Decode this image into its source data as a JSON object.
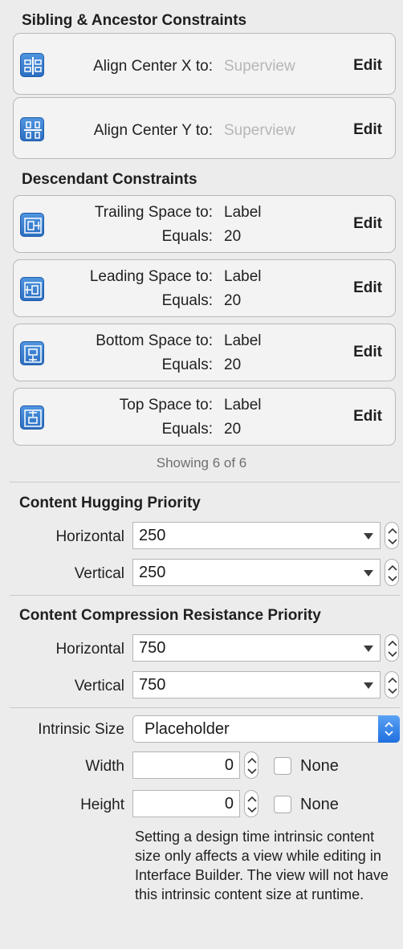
{
  "sibling_section": {
    "title": "Sibling & Ancestor Constraints",
    "constraints": [
      {
        "label": "Align Center X to:",
        "value": "Superview",
        "edit": "Edit",
        "icon": "align-center-x-icon"
      },
      {
        "label": "Align Center Y to:",
        "value": "Superview",
        "edit": "Edit",
        "icon": "align-center-y-icon"
      }
    ]
  },
  "descendant_section": {
    "title": "Descendant Constraints",
    "constraints": [
      {
        "label": "Trailing Space to:",
        "value": "Label",
        "equals_label": "Equals:",
        "equals_value": "20",
        "edit": "Edit",
        "icon": "trailing-space-icon"
      },
      {
        "label": "Leading Space to:",
        "value": "Label",
        "equals_label": "Equals:",
        "equals_value": "20",
        "edit": "Edit",
        "icon": "leading-space-icon"
      },
      {
        "label": "Bottom Space to:",
        "value": "Label",
        "equals_label": "Equals:",
        "equals_value": "20",
        "edit": "Edit",
        "icon": "bottom-space-icon"
      },
      {
        "label": "Top Space to:",
        "value": "Label",
        "equals_label": "Equals:",
        "equals_value": "20",
        "edit": "Edit",
        "icon": "top-space-icon"
      }
    ],
    "showing": "Showing 6 of 6"
  },
  "hugging": {
    "title": "Content Hugging Priority",
    "horizontal_label": "Horizontal",
    "horizontal_value": "250",
    "vertical_label": "Vertical",
    "vertical_value": "250"
  },
  "compression": {
    "title": "Content Compression Resistance Priority",
    "horizontal_label": "Horizontal",
    "horizontal_value": "750",
    "vertical_label": "Vertical",
    "vertical_value": "750"
  },
  "intrinsic": {
    "label": "Intrinsic Size",
    "value": "Placeholder",
    "width_label": "Width",
    "width_value": "0",
    "height_label": "Height",
    "height_value": "0",
    "none_label": "None",
    "note": "Setting a design time intrinsic content size only affects a view while editing in Interface Builder. The view will not have this intrinsic content size at runtime."
  },
  "colors": {
    "background": "#ececec",
    "card_background": "#f3f3f3",
    "icon_blue": "#2c6fc2",
    "popup_button_blue": "#1f6fde"
  }
}
